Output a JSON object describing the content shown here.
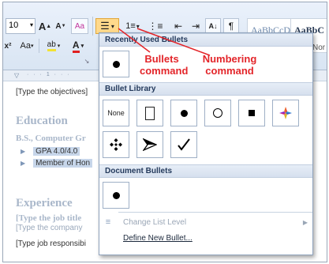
{
  "ribbon": {
    "font_size": "10",
    "grow_font": "A",
    "shrink_font": "A",
    "clear_format": "Aa",
    "change_case": "Aa",
    "highlight": "ab",
    "font_color": "A",
    "sort": "A↓",
    "pilcrow": "¶",
    "bullets_glyph": "☰",
    "numbering_glyph": "1≡",
    "styles": [
      {
        "preview": "AaBbCcDc",
        "name": ""
      },
      {
        "preview": "AaBbC",
        "name": "Nor"
      }
    ]
  },
  "document": {
    "lines": [
      "[Type the objectives]",
      "Education",
      "B.S., Computer Gr",
      "Experience",
      "[Type the job title",
      "[Type the company",
      "[Type job responsibi"
    ],
    "bullets": [
      "GPA 4.0/4.0",
      "Member of Hon"
    ]
  },
  "menu": {
    "recent_header": "Recently Used Bullets",
    "library_header": "Bullet Library",
    "document_header": "Document Bullets",
    "none_label": "None",
    "change_level": "Change List Level",
    "define_new": "Define New Bullet..."
  },
  "annotations": {
    "bullets_command": "Bullets\ncommand",
    "numbering_command": "Numbering\ncommand"
  },
  "colors": {
    "annotation_red": "#e3252a",
    "menu_header_text": "#243a5c",
    "accent_orange": "#f0b640"
  }
}
